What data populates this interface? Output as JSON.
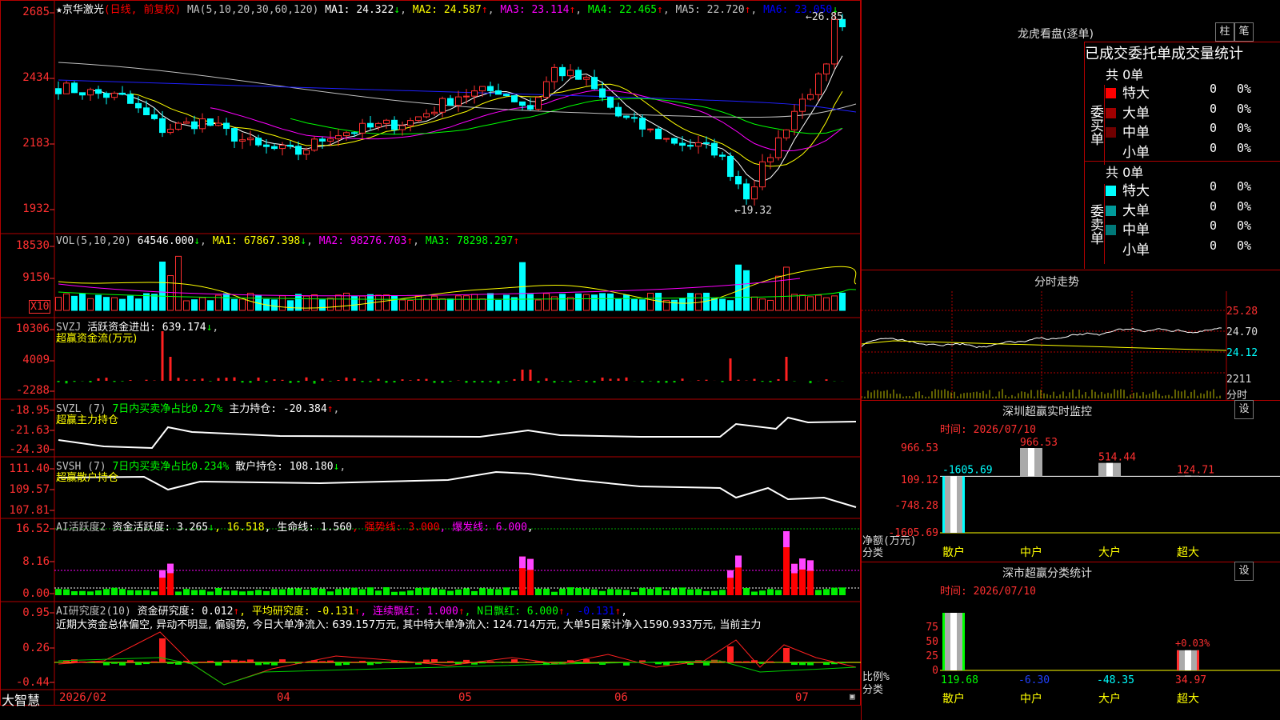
{
  "stock": {
    "star": "★",
    "name": "京华激光",
    "mode": "(日线, 前复权)"
  },
  "ma_header": {
    "label": "MA(5,10,20,30,60,120)",
    "items": [
      {
        "text": "MA1: 24.322",
        "arrow": "↓",
        "color": "#ffffff"
      },
      {
        "text": "MA2: 24.587",
        "arrow": "↑",
        "color": "#ffff00"
      },
      {
        "text": "MA3: 23.114",
        "arrow": "↑",
        "color": "#ff00ff"
      },
      {
        "text": "MA4: 22.465",
        "arrow": "↑",
        "color": "#00ff00"
      },
      {
        "text": "MA5: 22.720",
        "arrow": "↑",
        "color": "#c0c0c0"
      },
      {
        "text": "MA6: 23.050",
        "arrow": "↓",
        "color": "#0000ff"
      }
    ]
  },
  "price_axis": [
    "2685",
    "2434",
    "2183",
    "1932"
  ],
  "price_marks": {
    "high": "26.85",
    "low": "19.32"
  },
  "vol_header": {
    "label": "VOL(5,10,20)",
    "value": "64546.000",
    "arrow": "↓",
    "ma": [
      {
        "text": "MA1: 67867.398",
        "arrow": "↓",
        "color": "#ffff00"
      },
      {
        "text": "MA2: 98276.703",
        "arrow": "↑",
        "color": "#ff00ff"
      },
      {
        "text": "MA3: 78298.297",
        "arrow": "↑",
        "color": "#00ff00"
      }
    ]
  },
  "vol_axis": [
    "18530",
    "9150"
  ],
  "vol_unit": "X10",
  "svzj": {
    "label": "SVZJ",
    "title": "活跃资金进出: 639.174",
    "arrow": "↓",
    "sub": "超赢资金流(万元)",
    "axis": [
      "10306",
      "4009",
      "-2288"
    ]
  },
  "svzl": {
    "label": "SVZL (7)",
    "green_text": "7日内买卖净占比0.27%",
    "white_text": "主力持仓: -20.384",
    "arrow": "↑",
    "sub": "超赢主力持仓",
    "axis": [
      "-18.95",
      "-21.63",
      "-24.30"
    ]
  },
  "svsh": {
    "label": "SVSH (7)",
    "green_text": "7日内买卖净占比0.234%",
    "white_text": "散户持仓: 108.180",
    "arrow": "↓",
    "sub": "超赢散户持仓",
    "axis": [
      "111.40",
      "109.57",
      "107.81"
    ]
  },
  "ai_active": {
    "label": "AI活跃度2",
    "items": [
      {
        "text": "资金活跃度: 3.265",
        "color": "#ffffff"
      },
      {
        "text": "↓",
        "color": "#00ff00"
      },
      {
        "text": ", 16.518",
        "color": "#ffff00"
      },
      {
        "text": ", 生命线: 1.560",
        "color": "#ffffff"
      },
      {
        "text": ", 强势线: 3.000",
        "color": "#ff0000"
      },
      {
        "text": ", 爆发线: 6.000",
        "color": "#ff00ff"
      },
      {
        "text": ",",
        "color": "#ffffff"
      }
    ],
    "axis": [
      "16.52",
      "8.16",
      "0.00"
    ]
  },
  "ai_research": {
    "label": "AI研究度2(10)",
    "items": [
      {
        "text": "资金研究度: 0.012",
        "color": "#ffffff"
      },
      {
        "text": "↑",
        "color": "#ff0000"
      },
      {
        "text": ", 平均研究度: -0.131",
        "color": "#ffff00"
      },
      {
        "text": "↑",
        "color": "#ff0000"
      },
      {
        "text": ", 连续飘红: 1.000",
        "color": "#ff00ff"
      },
      {
        "text": "↑",
        "color": "#ff0000"
      },
      {
        "text": ", N日飘红: 6.000",
        "color": "#00ff00"
      },
      {
        "text": "↑",
        "color": "#ff0000"
      },
      {
        "text": ", -0.131",
        "color": "#0000ff"
      },
      {
        "text": "↑",
        "color": "#ff0000"
      },
      {
        "text": ",",
        "color": "#ffffff"
      }
    ],
    "summary": "近期大资金总体偏空, 异动不明显, 偏弱势, 今日大单净流入: 639.157万元, 其中特大单净流入: 124.714万元, 大单5日累计净入1590.933万元, 当前主力",
    "axis": [
      "0.95",
      "0.26",
      "-0.44"
    ]
  },
  "date_axis": [
    "2026/02",
    "04",
    "05",
    "06",
    "07"
  ],
  "brand": "大智慧",
  "right": {
    "dragon": {
      "title": "龙虎看盘(逐单)",
      "btn1": "柱",
      "btn2": "笔",
      "tabs": [
        "已成交",
        "委托单",
        "成交量统计"
      ],
      "buy": {
        "side": "委买单",
        "total": "共 0单",
        "rows": [
          {
            "label": "特大",
            "val": "0",
            "pct": "0%",
            "color": "#ff0000"
          },
          {
            "label": "大单",
            "val": "0",
            "pct": "0%",
            "color": "#a00000"
          },
          {
            "label": "中单",
            "val": "0",
            "pct": "0%",
            "color": "#700000"
          },
          {
            "label": "小单",
            "val": "0",
            "pct": "0%",
            "color": ""
          }
        ]
      },
      "sell": {
        "side": "委卖单",
        "total": "共 0单",
        "rows": [
          {
            "label": "特大",
            "val": "0",
            "pct": "0%",
            "color": "#00ffff"
          },
          {
            "label": "大单",
            "val": "0",
            "pct": "0%",
            "color": "#009a9a"
          },
          {
            "label": "中单",
            "val": "0",
            "pct": "0%",
            "color": "#007878"
          },
          {
            "label": "小单",
            "val": "0",
            "pct": "0%",
            "color": ""
          }
        ]
      }
    },
    "intraday": {
      "title": "分时走势",
      "axis": [
        "25.28",
        "24.70",
        "24.12",
        "2211",
        "分时"
      ]
    },
    "sz_monitor": {
      "title": "深圳超赢实时监控",
      "btn": "设",
      "time": "时间: 2026/07/10",
      "axis": [
        "966.53",
        "109.12",
        "-748.28",
        "-1605.69"
      ],
      "ylabel": "净额(万元)",
      "xlabel": "分类",
      "chart_data": {
        "type": "bar",
        "categories": [
          "散户",
          "中户",
          "大户",
          "超大"
        ],
        "values": [
          -1605.69,
          966.53,
          514.44,
          124.71
        ],
        "ylim": [
          -1605.69,
          966.53
        ]
      }
    },
    "sz_stats": {
      "title": "深市超赢分类统计",
      "btn": "设",
      "time": "时间: 2026/07/10",
      "axis": [
        "75",
        "50",
        "25",
        "0"
      ],
      "ylabel": "比例%",
      "xlabel": "分类",
      "annot": "+0.03%",
      "chart_data": {
        "type": "bar",
        "categories": [
          "散户",
          "中户",
          "大户",
          "超大"
        ],
        "values": [
          119.68,
          -6.3,
          -48.35,
          34.97
        ]
      }
    }
  },
  "chart_data": {
    "type": "candlestick",
    "x": [
      "2026/02",
      "04",
      "05",
      "06",
      "07"
    ],
    "high": 26.85,
    "low": 19.32,
    "ma": {
      "MA1": 24.322,
      "MA2": 24.587,
      "MA3": 23.114,
      "MA4": 22.465,
      "MA5": 22.72,
      "MA6": 23.05
    }
  }
}
